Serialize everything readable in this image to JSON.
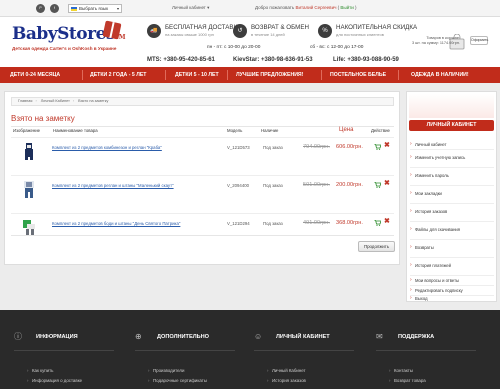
{
  "topbar": {
    "lang": "Выбрать язык",
    "account_menu": "Личный кабинет ▾",
    "welcome_prefix": "Добро пожаловать",
    "user": "Виталий Сергеевич",
    "logout": "Выйти"
  },
  "header": {
    "logo": "BabyStores",
    "logo_tm": "TM",
    "tagline": "Детская одежда Carter's и OshKosh в Украине",
    "features": [
      {
        "title": "БЕСПЛАТНАЯ ДОСТАВКА",
        "sub": "на заказы свыше 1000 грн"
      },
      {
        "title": "ВОЗВРАТ & ОБМЕН",
        "sub": "в течение 14 дней"
      },
      {
        "title": "НАКОПИТЕЛЬНАЯ СКИДКА",
        "sub": "для постоянных клиентов"
      }
    ],
    "hours_weekday": "пн - пт: с 10-00 до 20-00",
    "hours_weekend": "сб - вс: с 12-00 до 17-00",
    "cart_text1": "Товаров в корзине:",
    "cart_text2": "3 шт. на сумму: 1174.00грн.",
    "cart_btn": "Оформить"
  },
  "phones": {
    "mts": "MTS: +380-95-420-85-61",
    "kievstar": "KievStar: +380-98-636-91-53",
    "life": "Life: +380-93-088-90-59"
  },
  "nav": [
    "ДЕТИ 0-24 МЕСЯЦА",
    "ДЕТКИ 2 ГОДА - 5 ЛЕТ",
    "ДЕТКИ 5 - 10 ЛЕТ",
    "ЛУЧШИЕ ПРЕДЛОЖЕНИЯ!",
    "ПОСТЕЛЬНОЕ БЕЛЬЕ",
    "ОДЕЖДА В НАЛИЧИИ!"
  ],
  "breadcrumb": [
    "Главная",
    "Личный Кабинет",
    "Взято на заметку"
  ],
  "page_title": "Взято на заметку",
  "table": {
    "headers": {
      "image": "Изображение",
      "name": "Наименование товара",
      "model": "Модель",
      "availability": "Наличие",
      "price": "Цена",
      "action": "Действие"
    },
    "rows": [
      {
        "name": "Комплект из 2 предметов комбинезон и реглан \"Краба\"",
        "model": "V_121D573",
        "availability": "Под заказ",
        "old_price": "794.00грн.",
        "new_price": "606.00грн.",
        "color": "#1d2f5a"
      },
      {
        "name": "Комплект из 2 предметов реглан и штаны \"Маленький скаут\"",
        "model": "V_2094400",
        "availability": "Под заказ",
        "old_price": "501.00грн.",
        "new_price": "200.00грн.",
        "color": "#3a5b8a"
      },
      {
        "name": "Комплект из 2 предметов боди и штаны \"День Святого Патрика\"",
        "model": "V_121D294",
        "availability": "Под заказ",
        "old_price": "491.00грн.",
        "new_price": "368.00грн.",
        "color": "#2fa24a"
      }
    ]
  },
  "continue_btn": "Продолжить",
  "sidebar": {
    "title": "ЛИЧНЫЙ КАБИНЕТ",
    "items": [
      "Личный кабинет",
      "Изменить учетную запись",
      "Изменить пароль",
      "Мои закладки",
      "История заказов",
      "Файлы для скачивания",
      "Возвраты",
      "История платежей",
      "Мои вопросы и ответы",
      "Редактировать подписку",
      "Выход"
    ]
  },
  "footer": {
    "columns": [
      {
        "title": "ИНФОРМАЦИЯ",
        "icon": "info-icon",
        "links": [
          "Как купить",
          "Информация о доставке"
        ]
      },
      {
        "title": "ДОПОЛНИТЕЛЬНО",
        "icon": "plus-icon",
        "links": [
          "Производители",
          "Подарочные сертификаты"
        ]
      },
      {
        "title": "ЛИЧНЫЙ КАБИНЕТ",
        "icon": "user-icon",
        "links": [
          "Личный Кабинет",
          "История заказов"
        ]
      },
      {
        "title": "ПОДДЕРЖКА",
        "icon": "support-icon",
        "links": [
          "Контакты",
          "Возврат товара"
        ]
      }
    ]
  },
  "colors": {
    "brand_red": "#c12c1b",
    "brand_blue": "#1b2f8a",
    "footer": "#2a2a2a"
  }
}
